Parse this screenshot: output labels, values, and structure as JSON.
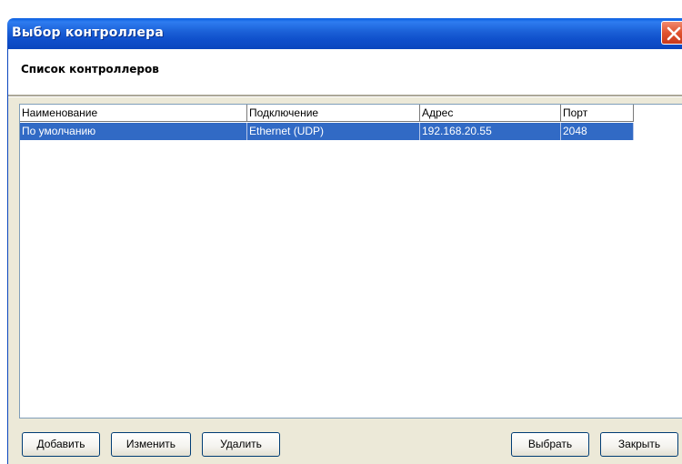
{
  "window": {
    "title": "Выбор контроллера"
  },
  "section": {
    "title": "Список контроллеров"
  },
  "table": {
    "columns": [
      "Наименование",
      "Подключение",
      "Адрес",
      "Порт"
    ],
    "rows": [
      {
        "name": "По умолчанию",
        "connection": "Ethernet (UDP)",
        "address": "192.168.20.55",
        "port": "2048",
        "selected": true
      }
    ]
  },
  "buttons": {
    "add": "Добавить",
    "edit": "Изменить",
    "delete": "Удалить",
    "select": "Выбрать",
    "close": "Закрыть"
  },
  "icons": {
    "close": "close-icon"
  },
  "colors": {
    "titlebar": "#0a46be",
    "selection": "#316ac5",
    "dialog_face": "#ece9d8",
    "close_button": "#e0532f"
  }
}
